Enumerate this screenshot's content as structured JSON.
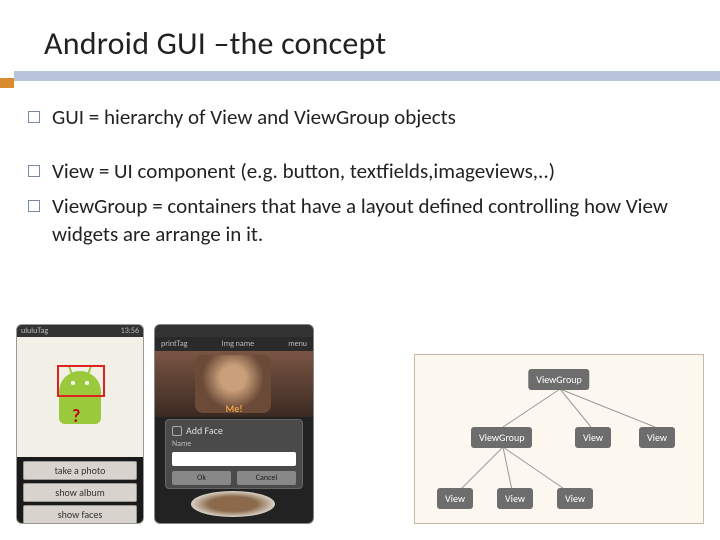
{
  "title": "Android GUI –the concept",
  "bullets": {
    "b1": "GUI = hierarchy of View and ViewGroup objects",
    "b2": "View = UI component (e.g. button, textfields,imageviews,..)",
    "b3": "ViewGroup = containers that have a layout defined controlling how View widgets are arrange in it."
  },
  "phone1": {
    "status_left": "ululuTag",
    "status_right": "13:56",
    "btn1": "take a photo",
    "btn2": "show album",
    "btn3": "show faces"
  },
  "phone2": {
    "top_left": "printTag",
    "top_mid": "Img name",
    "top_right": "menu",
    "face_label": "Me!",
    "dialog_title": "Add Face",
    "dialog_sub": "Name",
    "dlg_btn1": "Ok",
    "dlg_btn2": "Cancel"
  },
  "diagram": {
    "root": "ViewGroup",
    "vg2": "ViewGroup",
    "v1": "View",
    "v2": "View",
    "v3": "View",
    "v4": "View",
    "v5": "View"
  }
}
